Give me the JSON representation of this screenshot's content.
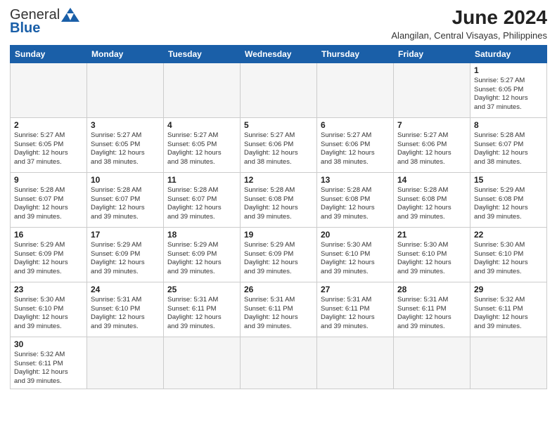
{
  "header": {
    "logo_general": "General",
    "logo_blue": "Blue",
    "month_title": "June 2024",
    "location": "Alangilan, Central Visayas, Philippines"
  },
  "days_of_week": [
    "Sunday",
    "Monday",
    "Tuesday",
    "Wednesday",
    "Thursday",
    "Friday",
    "Saturday"
  ],
  "weeks": [
    [
      {
        "day": "",
        "info": ""
      },
      {
        "day": "",
        "info": ""
      },
      {
        "day": "",
        "info": ""
      },
      {
        "day": "",
        "info": ""
      },
      {
        "day": "",
        "info": ""
      },
      {
        "day": "",
        "info": ""
      },
      {
        "day": "1",
        "info": "Sunrise: 5:27 AM\nSunset: 6:05 PM\nDaylight: 12 hours\nand 37 minutes."
      }
    ],
    [
      {
        "day": "2",
        "info": "Sunrise: 5:27 AM\nSunset: 6:05 PM\nDaylight: 12 hours\nand 37 minutes."
      },
      {
        "day": "3",
        "info": "Sunrise: 5:27 AM\nSunset: 6:05 PM\nDaylight: 12 hours\nand 38 minutes."
      },
      {
        "day": "4",
        "info": "Sunrise: 5:27 AM\nSunset: 6:05 PM\nDaylight: 12 hours\nand 38 minutes."
      },
      {
        "day": "5",
        "info": "Sunrise: 5:27 AM\nSunset: 6:06 PM\nDaylight: 12 hours\nand 38 minutes."
      },
      {
        "day": "6",
        "info": "Sunrise: 5:27 AM\nSunset: 6:06 PM\nDaylight: 12 hours\nand 38 minutes."
      },
      {
        "day": "7",
        "info": "Sunrise: 5:27 AM\nSunset: 6:06 PM\nDaylight: 12 hours\nand 38 minutes."
      },
      {
        "day": "8",
        "info": "Sunrise: 5:28 AM\nSunset: 6:07 PM\nDaylight: 12 hours\nand 38 minutes."
      }
    ],
    [
      {
        "day": "9",
        "info": "Sunrise: 5:28 AM\nSunset: 6:07 PM\nDaylight: 12 hours\nand 39 minutes."
      },
      {
        "day": "10",
        "info": "Sunrise: 5:28 AM\nSunset: 6:07 PM\nDaylight: 12 hours\nand 39 minutes."
      },
      {
        "day": "11",
        "info": "Sunrise: 5:28 AM\nSunset: 6:07 PM\nDaylight: 12 hours\nand 39 minutes."
      },
      {
        "day": "12",
        "info": "Sunrise: 5:28 AM\nSunset: 6:08 PM\nDaylight: 12 hours\nand 39 minutes."
      },
      {
        "day": "13",
        "info": "Sunrise: 5:28 AM\nSunset: 6:08 PM\nDaylight: 12 hours\nand 39 minutes."
      },
      {
        "day": "14",
        "info": "Sunrise: 5:28 AM\nSunset: 6:08 PM\nDaylight: 12 hours\nand 39 minutes."
      },
      {
        "day": "15",
        "info": "Sunrise: 5:29 AM\nSunset: 6:08 PM\nDaylight: 12 hours\nand 39 minutes."
      }
    ],
    [
      {
        "day": "16",
        "info": "Sunrise: 5:29 AM\nSunset: 6:09 PM\nDaylight: 12 hours\nand 39 minutes."
      },
      {
        "day": "17",
        "info": "Sunrise: 5:29 AM\nSunset: 6:09 PM\nDaylight: 12 hours\nand 39 minutes."
      },
      {
        "day": "18",
        "info": "Sunrise: 5:29 AM\nSunset: 6:09 PM\nDaylight: 12 hours\nand 39 minutes."
      },
      {
        "day": "19",
        "info": "Sunrise: 5:29 AM\nSunset: 6:09 PM\nDaylight: 12 hours\nand 39 minutes."
      },
      {
        "day": "20",
        "info": "Sunrise: 5:30 AM\nSunset: 6:10 PM\nDaylight: 12 hours\nand 39 minutes."
      },
      {
        "day": "21",
        "info": "Sunrise: 5:30 AM\nSunset: 6:10 PM\nDaylight: 12 hours\nand 39 minutes."
      },
      {
        "day": "22",
        "info": "Sunrise: 5:30 AM\nSunset: 6:10 PM\nDaylight: 12 hours\nand 39 minutes."
      }
    ],
    [
      {
        "day": "23",
        "info": "Sunrise: 5:30 AM\nSunset: 6:10 PM\nDaylight: 12 hours\nand 39 minutes."
      },
      {
        "day": "24",
        "info": "Sunrise: 5:31 AM\nSunset: 6:10 PM\nDaylight: 12 hours\nand 39 minutes."
      },
      {
        "day": "25",
        "info": "Sunrise: 5:31 AM\nSunset: 6:11 PM\nDaylight: 12 hours\nand 39 minutes."
      },
      {
        "day": "26",
        "info": "Sunrise: 5:31 AM\nSunset: 6:11 PM\nDaylight: 12 hours\nand 39 minutes."
      },
      {
        "day": "27",
        "info": "Sunrise: 5:31 AM\nSunset: 6:11 PM\nDaylight: 12 hours\nand 39 minutes."
      },
      {
        "day": "28",
        "info": "Sunrise: 5:31 AM\nSunset: 6:11 PM\nDaylight: 12 hours\nand 39 minutes."
      },
      {
        "day": "29",
        "info": "Sunrise: 5:32 AM\nSunset: 6:11 PM\nDaylight: 12 hours\nand 39 minutes."
      }
    ],
    [
      {
        "day": "30",
        "info": "Sunrise: 5:32 AM\nSunset: 6:11 PM\nDaylight: 12 hours\nand 39 minutes."
      },
      {
        "day": "",
        "info": ""
      },
      {
        "day": "",
        "info": ""
      },
      {
        "day": "",
        "info": ""
      },
      {
        "day": "",
        "info": ""
      },
      {
        "day": "",
        "info": ""
      },
      {
        "day": "",
        "info": ""
      }
    ]
  ]
}
